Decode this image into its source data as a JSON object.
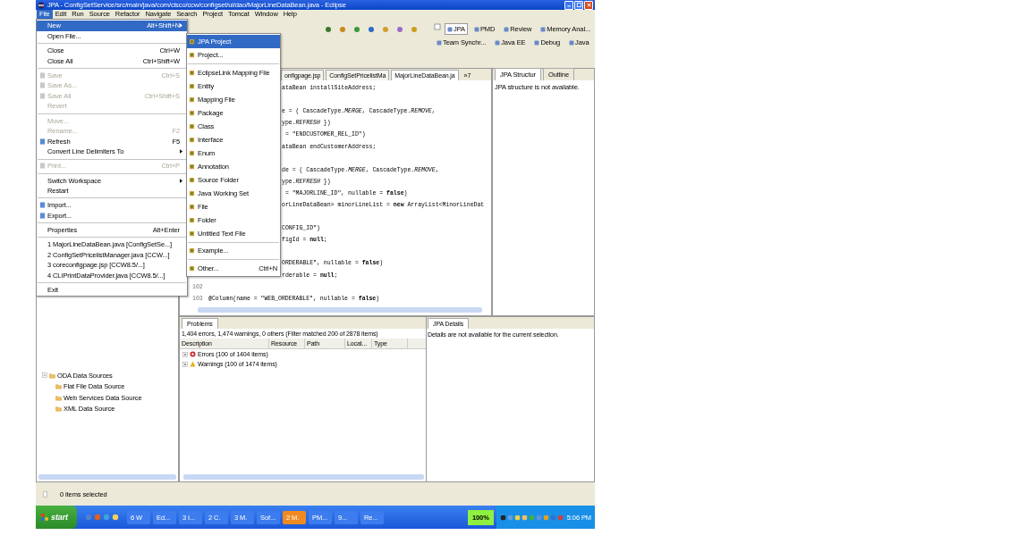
{
  "title": "JPA - ConfigSetService/src/main/java/com/cisco/ccw/configset/ui/dao/MajorLineDataBean.java - Eclipse",
  "menubar": [
    {
      "label": "File",
      "selected": true
    },
    {
      "label": "Edit",
      "selected": false
    },
    {
      "label": "Run",
      "selected": false
    },
    {
      "label": "Source",
      "selected": false
    },
    {
      "label": "Refactor",
      "selected": false
    },
    {
      "label": "Navigate",
      "selected": false
    },
    {
      "label": "Search",
      "selected": false
    },
    {
      "label": "Project",
      "selected": false
    },
    {
      "label": "Tomcat",
      "selected": false
    },
    {
      "label": "Window",
      "selected": false
    },
    {
      "label": "Help",
      "selected": false
    }
  ],
  "perspectives": [
    {
      "label": "JPA",
      "selected": true
    },
    {
      "label": "PMD",
      "selected": false
    },
    {
      "label": "Review",
      "selected": false
    },
    {
      "label": "Memory Anal...",
      "selected": false
    },
    {
      "label": "Team Synchr...",
      "selected": false
    },
    {
      "label": "Java EE",
      "selected": false
    },
    {
      "label": "Debug",
      "selected": false
    },
    {
      "label": "Java",
      "selected": false
    }
  ],
  "file_menu": [
    {
      "kind": "item",
      "label": "New",
      "shortcut": "Alt+Shift+N",
      "submenu": true,
      "selected": true,
      "disabled": false,
      "icon": false
    },
    {
      "kind": "item",
      "label": "Open File...",
      "submenu": false,
      "selected": false,
      "disabled": false,
      "icon": false
    },
    {
      "kind": "separator"
    },
    {
      "kind": "item",
      "label": "Close",
      "shortcut": "Ctrl+W",
      "submenu": false,
      "selected": false,
      "disabled": false,
      "icon": false
    },
    {
      "kind": "item",
      "label": "Close All",
      "shortcut": "Ctrl+Shift+W",
      "submenu": false,
      "selected": false,
      "disabled": false,
      "icon": false
    },
    {
      "kind": "separator"
    },
    {
      "kind": "item",
      "label": "Save",
      "shortcut": "Ctrl+S",
      "submenu": false,
      "selected": false,
      "disabled": true,
      "icon": true
    },
    {
      "kind": "item",
      "label": "Save As...",
      "submenu": false,
      "selected": false,
      "disabled": true,
      "icon": true
    },
    {
      "kind": "item",
      "label": "Save All",
      "shortcut": "Ctrl+Shift+S",
      "submenu": false,
      "selected": false,
      "disabled": true,
      "icon": true
    },
    {
      "kind": "item",
      "label": "Revert",
      "submenu": false,
      "selected": false,
      "disabled": true,
      "icon": false
    },
    {
      "kind": "separator"
    },
    {
      "kind": "item",
      "label": "Move...",
      "submenu": false,
      "selected": false,
      "disabled": true,
      "icon": false
    },
    {
      "kind": "item",
      "label": "Rename...",
      "shortcut": "F2",
      "submenu": false,
      "selected": false,
      "disabled": true,
      "icon": false
    },
    {
      "kind": "item",
      "label": "Refresh",
      "shortcut": "F5",
      "submenu": false,
      "selected": false,
      "disabled": false,
      "icon": true
    },
    {
      "kind": "item",
      "label": "Convert Line Delimiters To",
      "submenu": true,
      "selected": false,
      "disabled": false,
      "icon": false
    },
    {
      "kind": "separator"
    },
    {
      "kind": "item",
      "label": "Print...",
      "shortcut": "Ctrl+P",
      "submenu": false,
      "selected": false,
      "disabled": true,
      "icon": true
    },
    {
      "kind": "separator"
    },
    {
      "kind": "item",
      "label": "Switch Workspace",
      "submenu": true,
      "selected": false,
      "disabled": false,
      "icon": false
    },
    {
      "kind": "item",
      "label": "Restart",
      "submenu": false,
      "selected": false,
      "disabled": false,
      "icon": false
    },
    {
      "kind": "separator"
    },
    {
      "kind": "item",
      "label": "Import...",
      "submenu": false,
      "selected": false,
      "disabled": false,
      "icon": true
    },
    {
      "kind": "item",
      "label": "Export...",
      "submenu": false,
      "selected": false,
      "disabled": false,
      "icon": true
    },
    {
      "kind": "separator"
    },
    {
      "kind": "item",
      "label": "Properties",
      "shortcut": "Alt+Enter",
      "submenu": false,
      "selected": false,
      "disabled": false,
      "icon": false
    },
    {
      "kind": "separator"
    },
    {
      "kind": "item",
      "label": "1 MajorLineDataBean.java [ConfigSetSe...]",
      "submenu": false,
      "selected": false,
      "disabled": false,
      "icon": false
    },
    {
      "kind": "item",
      "label": "2 ConfigSetPricelistManager.java [CCW...]",
      "submenu": false,
      "selected": false,
      "disabled": false,
      "icon": false
    },
    {
      "kind": "item",
      "label": "3 coreconfigpage.jsp [CCW8.5/...]",
      "submenu": false,
      "selected": false,
      "disabled": false,
      "icon": false
    },
    {
      "kind": "item",
      "label": "4 CLIPrintDataProvider.java [CCW8.5/...]",
      "submenu": false,
      "selected": false,
      "disabled": false,
      "icon": false
    },
    {
      "kind": "separator"
    },
    {
      "kind": "item",
      "label": "Exit",
      "submenu": false,
      "selected": false,
      "disabled": false,
      "icon": false
    }
  ],
  "new_submenu": [
    {
      "kind": "item",
      "label": "JPA Project",
      "selected": true
    },
    {
      "kind": "item",
      "label": "Project...",
      "selected": false
    },
    {
      "kind": "separator"
    },
    {
      "kind": "item",
      "label": "EclipseLink Mapping File",
      "selected": false
    },
    {
      "kind": "item",
      "label": "Entity",
      "selected": false
    },
    {
      "kind": "item",
      "label": "Mapping File",
      "selected": false
    },
    {
      "kind": "item",
      "label": "Package",
      "selected": false
    },
    {
      "kind": "item",
      "label": "Class",
      "selected": false
    },
    {
      "kind": "item",
      "label": "Interface",
      "selected": false
    },
    {
      "kind": "item",
      "label": "Enum",
      "selected": false
    },
    {
      "kind": "item",
      "label": "Annotation",
      "selected": false
    },
    {
      "kind": "item",
      "label": "Source Folder",
      "selected": false
    },
    {
      "kind": "item",
      "label": "Java Working Set",
      "selected": false
    },
    {
      "kind": "item",
      "label": "File",
      "selected": false
    },
    {
      "kind": "item",
      "label": "Folder",
      "selected": false
    },
    {
      "kind": "item",
      "label": "Untitled Text File",
      "selected": false
    },
    {
      "kind": "separator"
    },
    {
      "kind": "item",
      "label": "Example...",
      "selected": false
    },
    {
      "kind": "separator"
    },
    {
      "kind": "item",
      "label": "Other...",
      "shortcut": "Ctrl+N",
      "selected": false
    }
  ],
  "editor_tabs": [
    {
      "label": "onfigpage.jsp",
      "selected": false
    },
    {
      "label": "ConfigSetPricelistMa",
      "selected": false
    },
    {
      "label": "MajorLineDataBean.ja",
      "selected": true
    }
  ],
  "editor_overflow": "»7",
  "code_lines": [
    {
      "kind": "code",
      "text": "ataBean installSiteAddress;"
    },
    {
      "kind": "blank"
    },
    {
      "kind": "code",
      "text": "e = ( CascadeType.*MERGE*, CascadeType.*REMOVE*,"
    },
    {
      "kind": "code",
      "text": "ype.*REFRESH* })"
    },
    {
      "kind": "code",
      "text": " = \"ENDCUSTOMER_REL_ID\")"
    },
    {
      "kind": "code",
      "text": "ataBean endCustomerAddress;"
    },
    {
      "kind": "blank"
    },
    {
      "kind": "code",
      "text": "de = ( CascadeType.*MERGE*, CascadeType.*REMOVE*,"
    },
    {
      "kind": "code",
      "text": "ype.*REFRESH* })"
    },
    {
      "kind": "code",
      "text": " = \"MAJORLINE_ID\", nullable = **false**)"
    },
    {
      "kind": "code",
      "text": "orLineDataBean> minorLineList = **new** ArrayList<MinorLineDat"
    },
    {
      "kind": "blank"
    },
    {
      "kind": "code",
      "text": "CONFIG_ID\")"
    },
    {
      "kind": "code",
      "text": "figId = **null**;"
    },
    {
      "kind": "blank"
    },
    {
      "kind": "code",
      "text": "ORDERABLE\", nullable = **false**)"
    },
    {
      "kind": "code",
      "text": "rderable = **null**;"
    },
    {
      "kind": "numbered",
      "number": "102"
    },
    {
      "kind": "numbered",
      "number": "103",
      "text": "@Column(name = \"WEB_ORDERABLE\", nullable = **false**)"
    }
  ],
  "structure_tabs": [
    {
      "label": "JPA Structur",
      "selected": true
    },
    {
      "label": "Outline",
      "selected": false
    }
  ],
  "structure_message": "JPA structure is not available.",
  "explorer_tree": [
    {
      "label": "ODA Data Sources",
      "expanded": true,
      "children": [
        {
          "label": "Flat File Data Source"
        },
        {
          "label": "Web Services Data Source"
        },
        {
          "label": "XML Data Source"
        }
      ]
    }
  ],
  "problems": {
    "tab": "Problems",
    "summary": "1,404 errors, 1,474 warnings, 0 others (Filter matched 200 of 2878 items)",
    "columns": [
      "Description",
      "Resource",
      "Path",
      "Locat...",
      "Type"
    ],
    "rows": [
      {
        "kind": "error",
        "label": "Errors (100 of 1404 items)",
        "expanded": false
      },
      {
        "kind": "warning",
        "label": "Warnings (100 of 1474 items)",
        "expanded": false
      }
    ]
  },
  "details": {
    "tab": "JPA Details",
    "message": "Details are not available for the current selection."
  },
  "status_bar": "0 items selected",
  "taskbar": {
    "start": "start",
    "tasks": [
      {
        "label": "6 W",
        "selected": false
      },
      {
        "label": "Ed...",
        "selected": false
      },
      {
        "label": "3 I...",
        "selected": false
      },
      {
        "label": "2 C.",
        "selected": false
      },
      {
        "label": "3 M.",
        "selected": false
      },
      {
        "label": "Sof...",
        "selected": false
      },
      {
        "label": "2 M.",
        "selected": true
      },
      {
        "label": "PM...",
        "selected": false
      },
      {
        "label": "9...",
        "selected": false
      },
      {
        "label": "Re...",
        "selected": false
      }
    ],
    "meter": "100%",
    "clock": "5:06 PM"
  }
}
